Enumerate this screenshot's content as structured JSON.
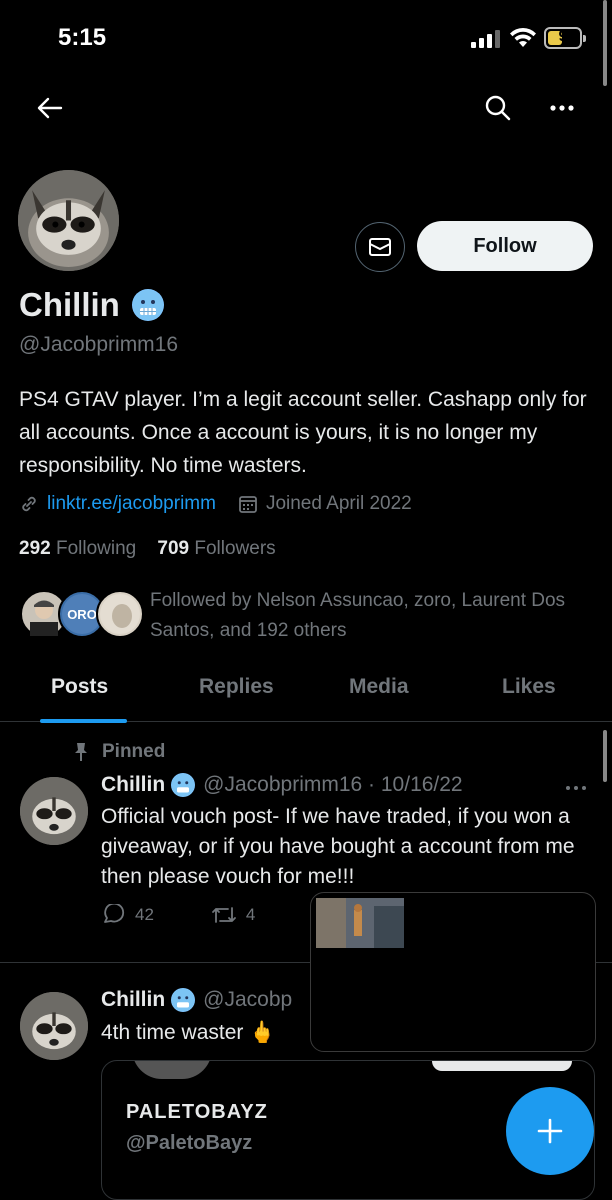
{
  "status_bar": {
    "time": "5:15",
    "battery": "9"
  },
  "profile": {
    "name": "Chillin",
    "handle": "@Jacobprimm16",
    "bio": "PS4 GTAV player. I’m a legit account seller. Cashapp only for all accounts. Once a account is yours, it is no longer my responsibility. No time wasters.",
    "link": "linktr.ee/jacobprimm",
    "joined": "Joined April 2022",
    "following_count": "292",
    "following_label": "Following",
    "followers_count": "709",
    "followers_label": "Followers",
    "followed_by": "Followed by Nelson Assuncao, zoro, Laurent Dos Santos, and 192 others",
    "follow_label": "Follow"
  },
  "tabs": [
    {
      "label": "Posts"
    },
    {
      "label": "Replies"
    },
    {
      "label": "Media"
    },
    {
      "label": "Likes"
    }
  ],
  "posts": [
    {
      "pinned_label": "Pinned",
      "name": "Chillin",
      "handle_date": "@Jacobprimm16 · 10/16/22",
      "text": "Official vouch post- If we have traded, if you won a giveaway, or if you have bought a account from me then please vouch for me!!!",
      "replies": "42",
      "reposts": "4"
    },
    {
      "name": "Chillin",
      "handle_date": "@Jacobp",
      "text": "4th time waster 🖕",
      "quote": {
        "name": "PALETOBAYZ",
        "handle": "@PaletoBayz"
      }
    }
  ],
  "colors": {
    "accent": "#1d9bf0",
    "background": "#000000",
    "muted": "#71767b"
  }
}
